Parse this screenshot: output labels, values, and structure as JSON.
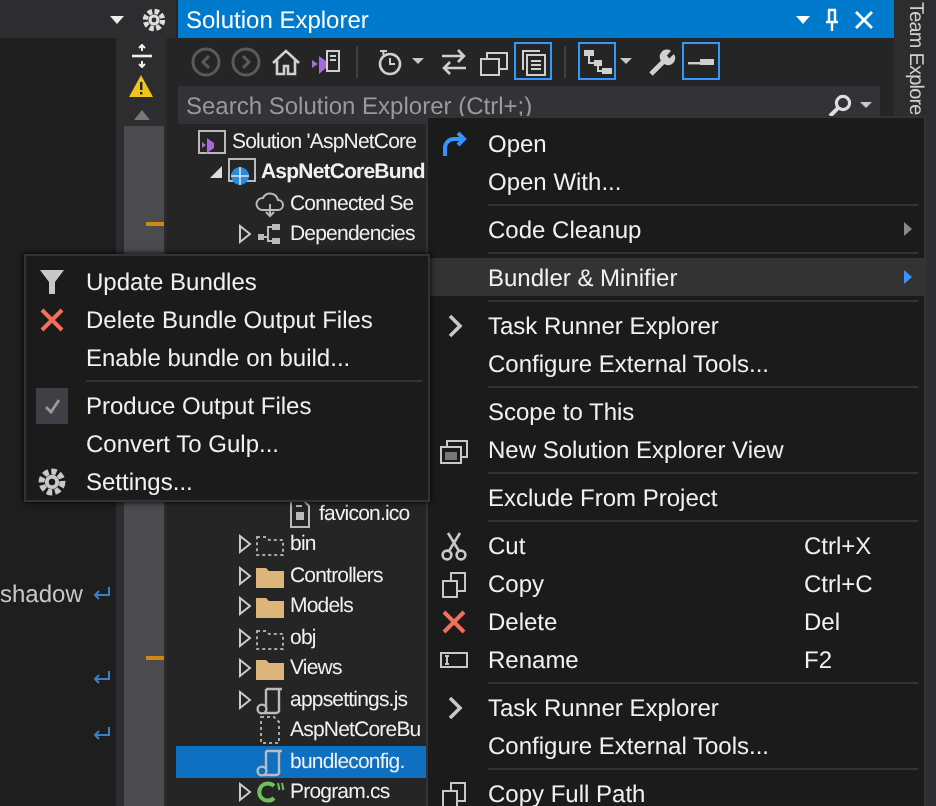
{
  "editor": {
    "lines": [
      {
        "text": "shadow",
        "wrap": true
      },
      {
        "wrap": false
      },
      {
        "wrap": false
      },
      {
        "wrap": true
      },
      {
        "wrap": false
      },
      {
        "wrap": true
      }
    ]
  },
  "solution_explorer": {
    "title": "Solution Explorer",
    "toolbar": [
      {
        "kind": "button",
        "disabled": true,
        "on": false,
        "dropdown": false
      },
      {
        "kind": "button",
        "disabled": true,
        "on": false,
        "dropdown": false
      },
      {
        "kind": "button",
        "disabled": false,
        "on": false,
        "dropdown": false
      },
      {
        "kind": "button",
        "disabled": false,
        "on": false,
        "dropdown": false
      },
      {
        "kind": "separator"
      },
      {
        "kind": "button",
        "disabled": false,
        "on": false,
        "dropdown": true
      },
      {
        "kind": "button",
        "disabled": false,
        "on": false,
        "dropdown": false
      },
      {
        "kind": "button",
        "disabled": false,
        "on": false,
        "dropdown": false
      },
      {
        "kind": "button",
        "disabled": false,
        "on": true,
        "dropdown": false
      },
      {
        "kind": "separator"
      },
      {
        "kind": "button",
        "disabled": false,
        "on": true,
        "dropdown": true
      },
      {
        "kind": "button",
        "disabled": false,
        "on": false,
        "dropdown": false
      },
      {
        "kind": "button",
        "disabled": false,
        "on": true,
        "dropdown": false
      }
    ],
    "search": {
      "placeholder": "Search Solution Explorer (Ctrl+;)"
    },
    "tree": [
      {
        "label": "Solution 'AspNetCore",
        "kind": "solution",
        "selected": false,
        "children": [
          {
            "label": "AspNetCoreBund",
            "kind": "project",
            "expanded": true,
            "selected": false,
            "children": [
              {
                "label": "Connected Se",
                "kind": "cloud",
                "selected": false
              },
              {
                "label": "Dependencies",
                "kind": "dependencies",
                "expanded": false,
                "selected": false
              },
              {
                "children": [
                  {
                    "label": "favicon.ico",
                    "kind": "ico",
                    "selected": false
                  }
                ]
              },
              {
                "label": "bin",
                "kind": "folder-dashed",
                "expanded": false,
                "selected": false
              },
              {
                "label": "Controllers",
                "kind": "folder",
                "expanded": false,
                "selected": false
              },
              {
                "label": "Models",
                "kind": "folder",
                "expanded": false,
                "selected": false
              },
              {
                "label": "obj",
                "kind": "folder-dashed",
                "expanded": false,
                "selected": false
              },
              {
                "label": "Views",
                "kind": "folder",
                "expanded": false,
                "selected": false
              },
              {
                "label": "appsettings.js",
                "kind": "config",
                "expanded": false,
                "selected": false
              },
              {
                "label": "AspNetCoreBu",
                "kind": "file-dashed",
                "selected": false
              },
              {
                "label": "bundleconfig.",
                "kind": "config",
                "selected": true
              },
              {
                "label": "Program.cs",
                "kind": "csharp",
                "expanded": false,
                "selected": false
              }
            ]
          }
        ]
      }
    ]
  },
  "side_tab": {
    "label": "Team Explore"
  },
  "context_menu": {
    "items": [
      {
        "kind": "item",
        "label": "Open",
        "selected": false,
        "submenu": false
      },
      {
        "kind": "item",
        "label": "Open With...",
        "selected": false,
        "submenu": false
      },
      {
        "kind": "separator"
      },
      {
        "kind": "item",
        "label": "Code Cleanup",
        "selected": false,
        "submenu": true
      },
      {
        "kind": "separator"
      },
      {
        "kind": "item",
        "label": "Bundler & Minifier",
        "selected": true,
        "submenu": true
      },
      {
        "kind": "separator"
      },
      {
        "kind": "item",
        "label": "Task Runner Explorer",
        "selected": false,
        "submenu": false
      },
      {
        "kind": "item",
        "label": "Configure External Tools...",
        "selected": false,
        "submenu": false
      },
      {
        "kind": "separator"
      },
      {
        "kind": "item",
        "label": "Scope to This",
        "selected": false,
        "submenu": false
      },
      {
        "kind": "item",
        "label": "New Solution Explorer View",
        "selected": false,
        "submenu": false
      },
      {
        "kind": "separator"
      },
      {
        "kind": "item",
        "label": "Exclude From Project",
        "selected": false,
        "submenu": false
      },
      {
        "kind": "separator"
      },
      {
        "kind": "item",
        "label": "Cut",
        "shortcut": "Ctrl+X",
        "selected": false,
        "submenu": false
      },
      {
        "kind": "item",
        "label": "Copy",
        "shortcut": "Ctrl+C",
        "selected": false,
        "submenu": false
      },
      {
        "kind": "item",
        "label": "Delete",
        "shortcut": "Del",
        "selected": false,
        "submenu": false
      },
      {
        "kind": "item",
        "label": "Rename",
        "shortcut": "F2",
        "selected": false,
        "submenu": false
      },
      {
        "kind": "separator"
      },
      {
        "kind": "item",
        "label": "Task Runner Explorer",
        "selected": false,
        "submenu": false
      },
      {
        "kind": "item",
        "label": "Configure External Tools...",
        "selected": false,
        "submenu": false
      },
      {
        "kind": "separator"
      },
      {
        "kind": "item",
        "label": "Copy Full Path",
        "selected": false,
        "submenu": false
      }
    ]
  },
  "submenu": {
    "items": [
      {
        "kind": "item",
        "label": "Update Bundles",
        "checked": false
      },
      {
        "kind": "item",
        "label": "Delete Bundle Output Files",
        "checked": false
      },
      {
        "kind": "item",
        "label": "Enable bundle on build...",
        "checked": false
      },
      {
        "kind": "separator"
      },
      {
        "kind": "item",
        "label": "Produce Output Files",
        "checked": true
      },
      {
        "kind": "item",
        "label": "Convert To Gulp...",
        "checked": false
      },
      {
        "kind": "item",
        "label": "Settings...",
        "checked": false
      }
    ]
  }
}
